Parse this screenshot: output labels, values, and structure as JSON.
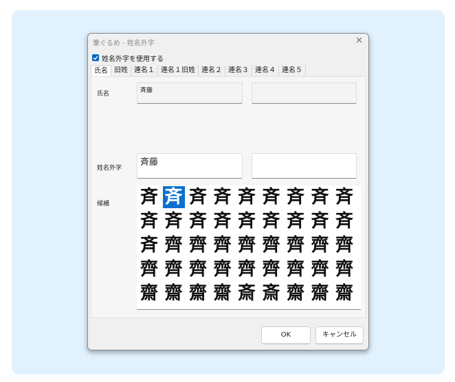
{
  "window": {
    "title": "筆ぐるめ - 姓名外字",
    "close_glyph": "✕"
  },
  "checkbox": {
    "label": "姓名外字を使用する",
    "checked": true
  },
  "tabs": [
    "氏名",
    "旧姓",
    "連名１",
    "連名１旧姓",
    "連名２",
    "連名３",
    "連名４",
    "連名５"
  ],
  "form": {
    "name_label": "氏名",
    "name_value": "斉藤",
    "gaiji_label": "姓名外字",
    "gaiji_value": "斉藤",
    "candidates_label": "候補"
  },
  "candidates": {
    "selected_index": 1,
    "chars": [
      "斉",
      "斉",
      "斉",
      "斉",
      "斉",
      "斉",
      "斉",
      "斉",
      "斉",
      "斉",
      "斉",
      "斉",
      "斉",
      "斉",
      "斉",
      "斉",
      "斉",
      "斉",
      "斉",
      "齊",
      "齊",
      "齊",
      "齊",
      "齊",
      "齊",
      "齊",
      "齊",
      "齊",
      "齊",
      "齊",
      "齊",
      "齊",
      "齊",
      "齊",
      "齊",
      "齊",
      "齋",
      "齋",
      "齋",
      "齋",
      "斎",
      "斎",
      "齋",
      "齋",
      "齋"
    ]
  },
  "buttons": {
    "ok": "OK",
    "cancel": "キャンセル"
  },
  "colors": {
    "accent": "#0067c0",
    "selection": "#0b6fd0",
    "background": "#e1f2fe"
  }
}
